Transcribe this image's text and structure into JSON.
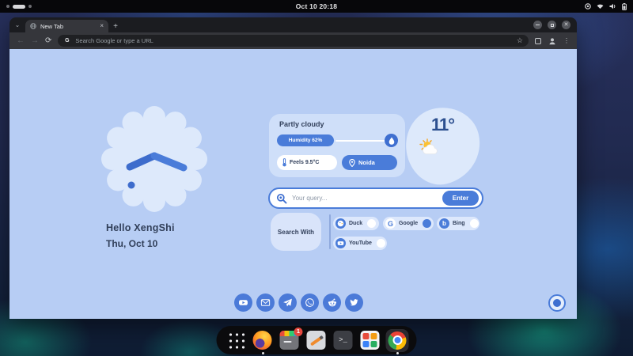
{
  "topbar": {
    "clock": "Oct 10 20:18"
  },
  "browser": {
    "tab_title": "New Tab",
    "tab_close": "×",
    "new_tab_button": "+",
    "back": "←",
    "forward": "→",
    "reload": "⟳",
    "url_placeholder": "Search Google or type a URL",
    "url_engine_letter": "G",
    "bookmark_star": "☆",
    "menu_dots": "⋮"
  },
  "newtab": {
    "greeting": "Hello XengShi",
    "date": "Thu, Oct 10",
    "weather": {
      "condition": "Partly cloudy",
      "humidity_label": "Humidity 62%",
      "humidity_pct": 62,
      "feels_label": "Feels 9.5°C",
      "location": "Noida",
      "temperature": "11°"
    },
    "search": {
      "placeholder": "Your query...",
      "enter_label": "Enter"
    },
    "search_with": {
      "label": "Search With",
      "engines": [
        {
          "name": "Duck",
          "active": false,
          "icon_letter": ""
        },
        {
          "name": "Google",
          "active": true,
          "icon_letter": "G"
        },
        {
          "name": "Bing",
          "active": false,
          "icon_letter": "b"
        },
        {
          "name": "YouTube",
          "active": false,
          "icon_letter": ""
        }
      ]
    },
    "social_links": [
      "youtube",
      "mail",
      "telegram",
      "whatsapp",
      "reddit",
      "twitter"
    ]
  },
  "dock": {
    "apps": [
      "app-grid",
      "firefox",
      "software-updater",
      "text-editor",
      "terminal",
      "app-store",
      "chrome"
    ],
    "updater_badge": "1",
    "terminal_glyph": ">_"
  },
  "colors": {
    "accent_blue": "#4a7cd9",
    "page_background": "#b7cdf4",
    "card_background": "#cfdff9",
    "blob_background": "#dde9fb",
    "dark_text": "#33415c"
  }
}
